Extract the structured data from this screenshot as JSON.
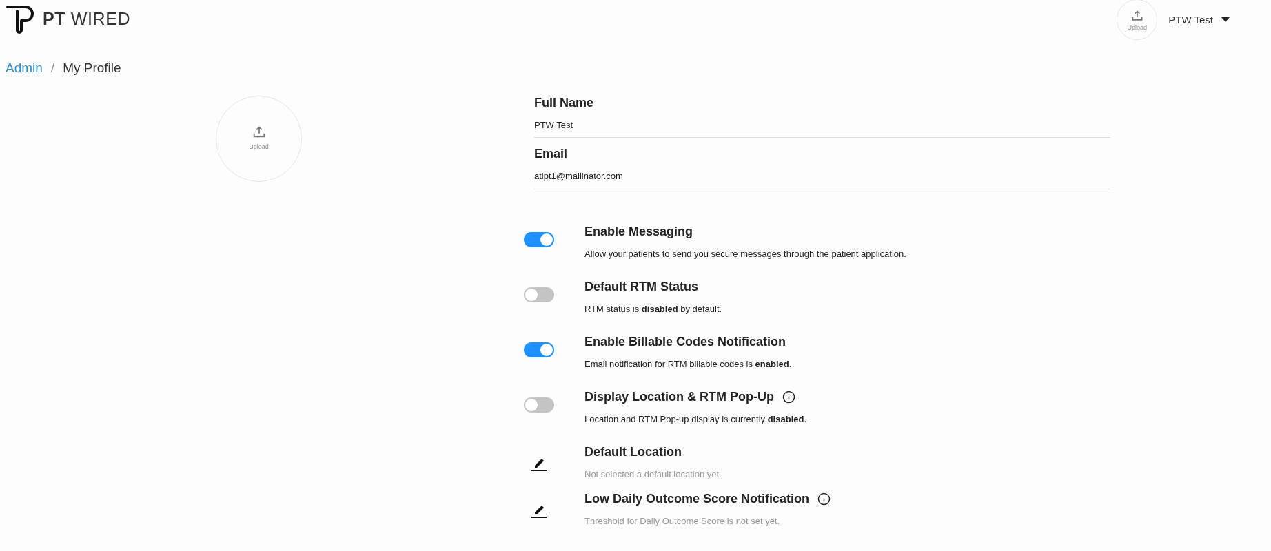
{
  "header": {
    "logo_text_bold": "PT",
    "logo_text": "WIRED",
    "avatar_label": "Upload",
    "user_name": "PTW Test"
  },
  "breadcrumb": [
    {
      "label": "Admin",
      "link": true
    },
    {
      "label": "My Profile",
      "link": false
    }
  ],
  "breadcrumb_separator": "/",
  "profile": {
    "avatar_label": "Upload",
    "fields": [
      {
        "label": "Full Name",
        "value": "PTW Test"
      },
      {
        "label": "Email",
        "value": "atipt1@mailinator.com"
      }
    ]
  },
  "settings": [
    {
      "kind": "toggle",
      "title": "Enable Messaging",
      "description": "Allow your patients to send you secure messages through the patient application.",
      "on": true,
      "info": false
    },
    {
      "kind": "toggle",
      "title": "Default RTM Status",
      "description": "RTM status is **disabled** by default.",
      "on": false,
      "info": false
    },
    {
      "kind": "toggle",
      "title": "Enable Billable Codes Notification",
      "description": "Email notification for RTM billable codes is **enabled**.",
      "on": true,
      "info": false
    },
    {
      "kind": "toggle",
      "title": "Display Location & RTM Pop-Up",
      "description": "Location and RTM Pop-up display is currently **disabled**.",
      "on": false,
      "info": true
    },
    {
      "kind": "edit",
      "title": "Default Location",
      "description": "Not selected a default location yet.",
      "info": false
    },
    {
      "kind": "edit",
      "title": "Low Daily Outcome Score Notification",
      "description": "Threshold for Daily Outcome Score is not set yet.",
      "info": true
    }
  ]
}
